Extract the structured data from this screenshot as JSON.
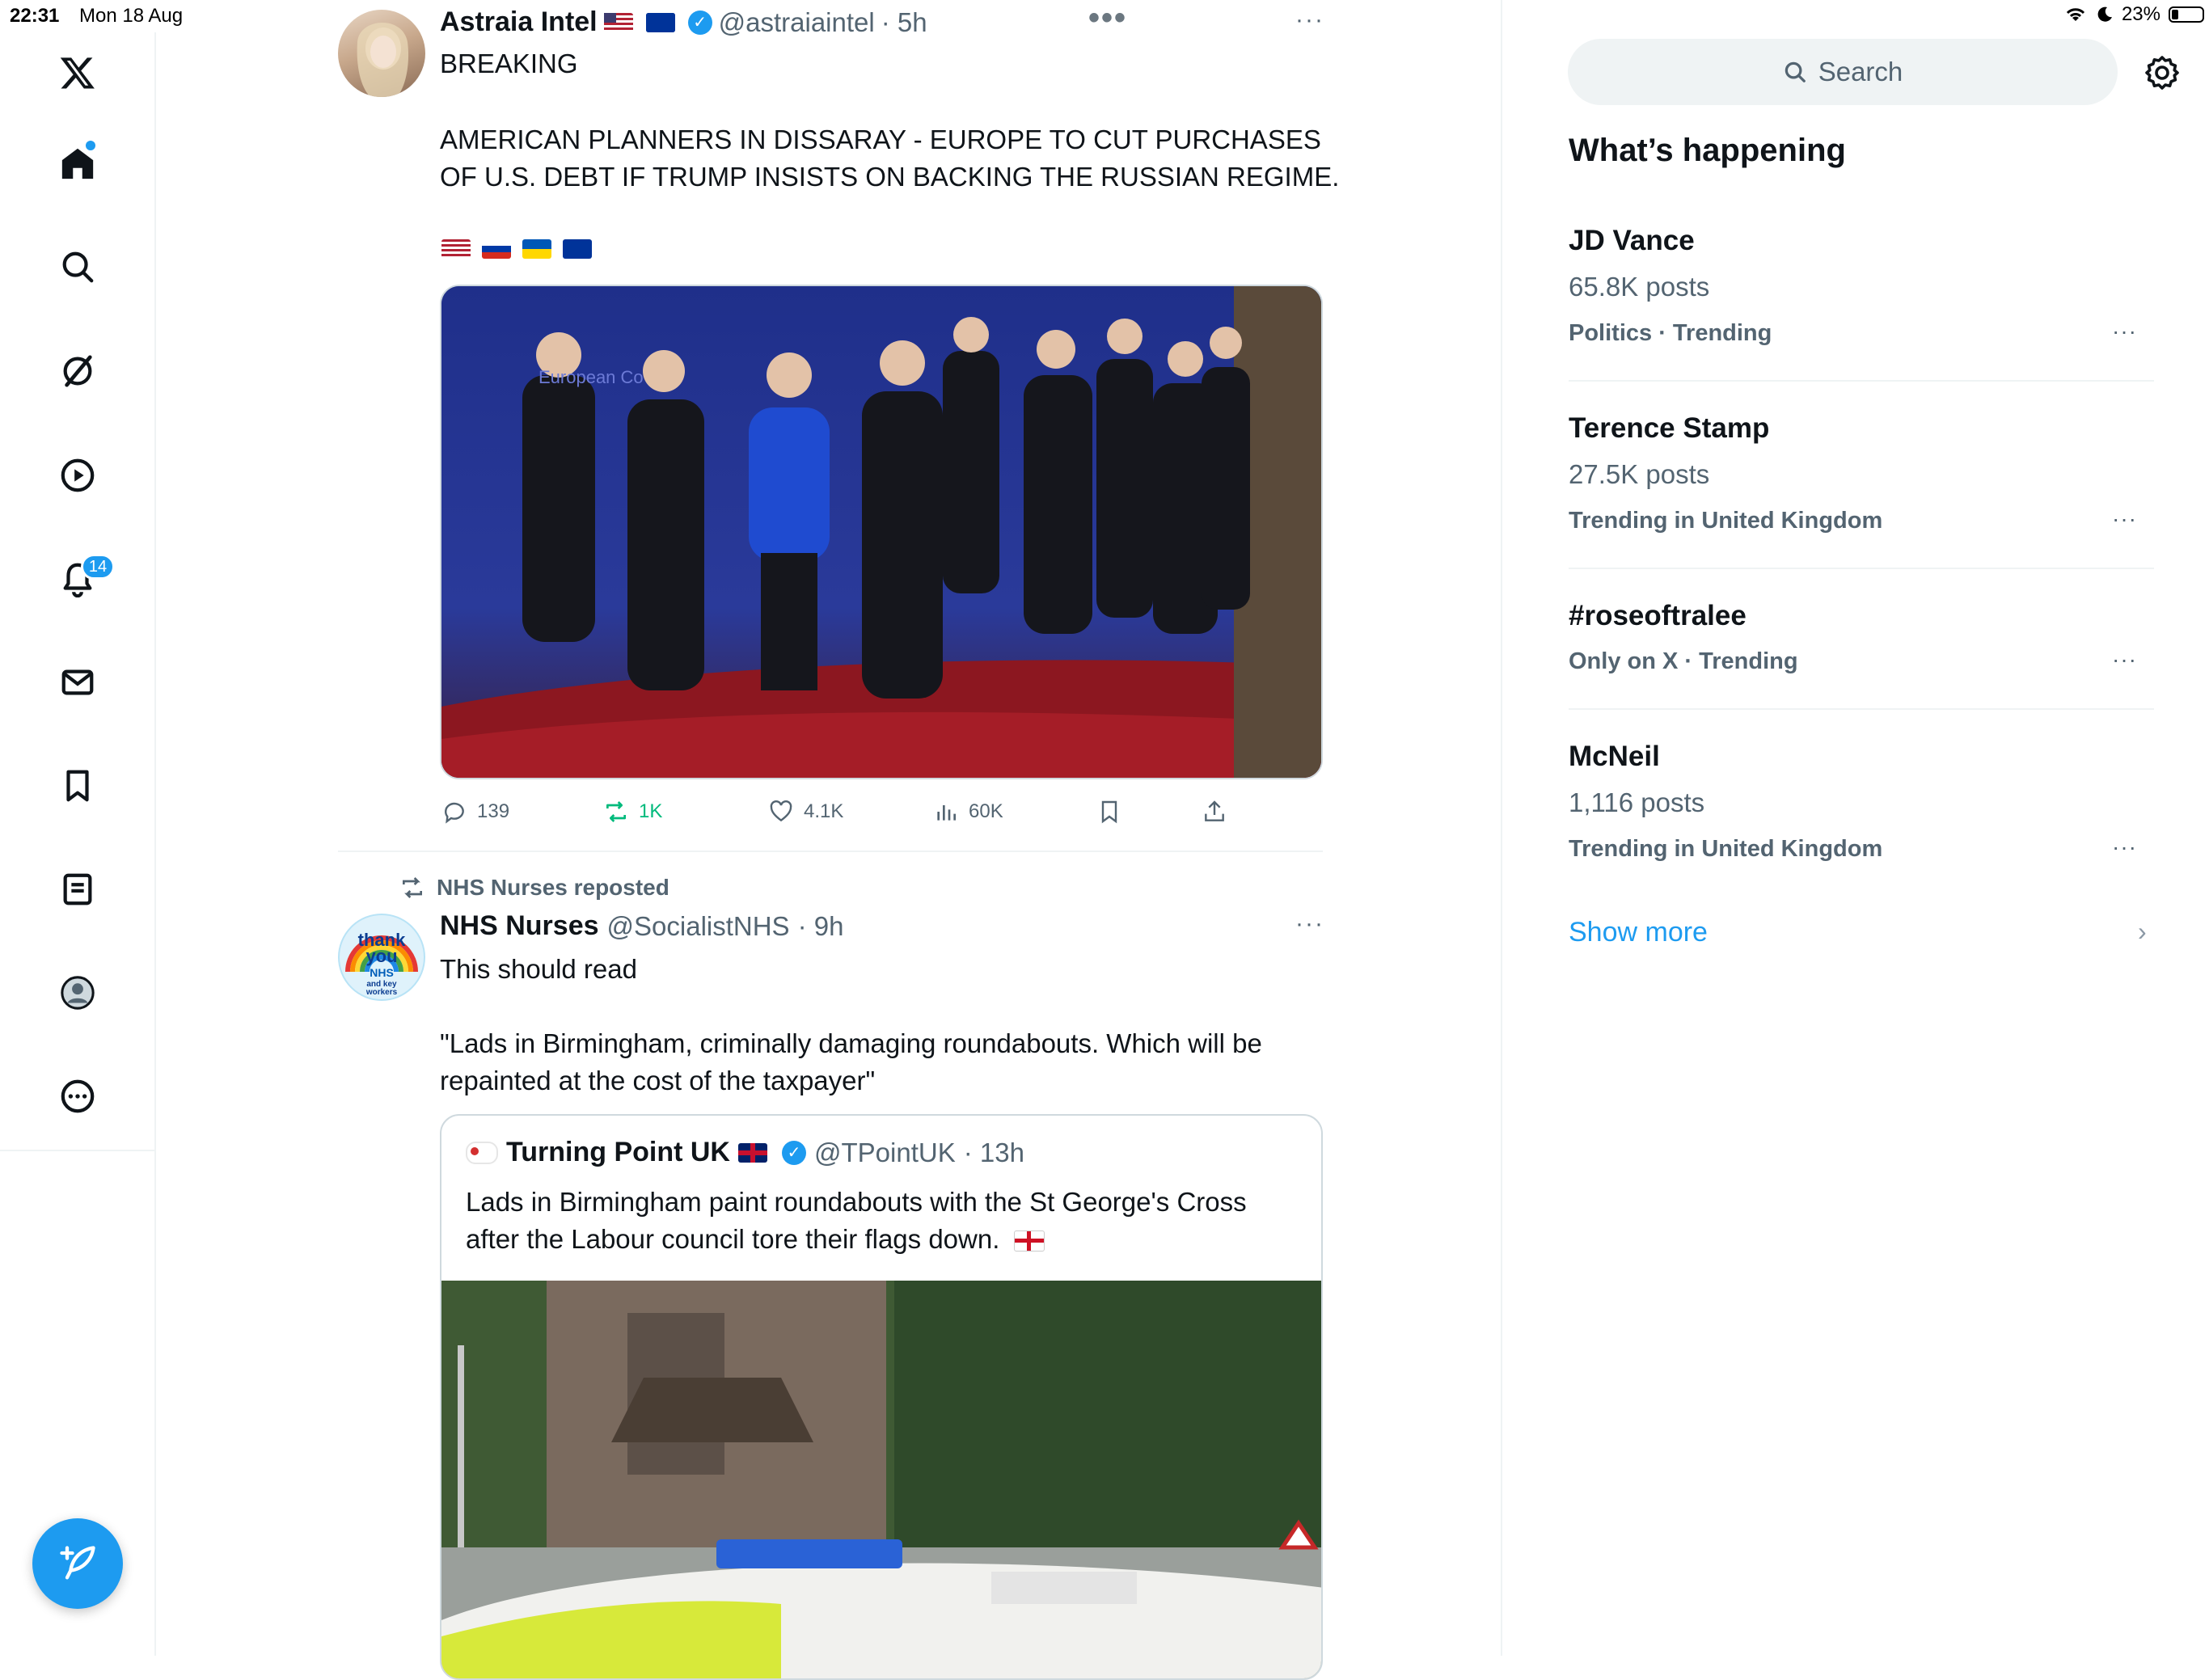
{
  "status_bar": {
    "time": "22:31",
    "date": "Mon 18 Aug",
    "battery": "23%",
    "battery_level": 0.23
  },
  "nav": {
    "items": [
      {
        "icon": "x-logo-icon"
      },
      {
        "icon": "home-icon"
      },
      {
        "icon": "search-icon"
      },
      {
        "icon": "grok-icon"
      },
      {
        "icon": "video-icon"
      },
      {
        "icon": "notifications-icon"
      },
      {
        "icon": "messages-icon"
      },
      {
        "icon": "bookmarks-icon"
      },
      {
        "icon": "lists-icon"
      },
      {
        "icon": "profile-icon"
      },
      {
        "icon": "more-icon"
      }
    ],
    "notifications_badge": "14",
    "compose_icon": "compose-icon"
  },
  "feed": {
    "post1": {
      "name": "Astraia Intel",
      "handle": "@astraiaintel",
      "time": "· 5h",
      "line1": "BREAKING",
      "line2": "AMERICAN PLANNERS IN DISSARAY - EUROPE TO CUT PURCHASES",
      "line3": "OF U.S. DEBT IF TRUMP INSISTS ON BACKING THE RUSSIAN REGIME.",
      "actions": {
        "replies": "139",
        "reposts": "1K",
        "likes": "4.1K",
        "views": "60K"
      }
    },
    "post2": {
      "repost_label": "NHS Nurses reposted",
      "name": "NHS Nurses",
      "handle": "@SocialistNHS",
      "time": "· 9h",
      "avatar_text_1": "thank",
      "avatar_text_2": "you",
      "avatar_text_3": "NHS",
      "avatar_text_4": "and key",
      "avatar_text_5": "workers",
      "line1": "This should read",
      "line2": "\"Lads in Birmingham, criminally damaging roundabouts. Which will be",
      "line3": "repainted at the cost of the taxpayer\"",
      "quote": {
        "name": "Turning Point UK",
        "handle": "@TPointUK",
        "time": "· 13h",
        "line1": "Lads in Birmingham paint roundabouts with the St George's Cross",
        "line2": "after the Labour council tore their flags down."
      }
    }
  },
  "sidebar": {
    "search_placeholder": "Search",
    "heading": "What’s happening",
    "trends": [
      {
        "title": "JD Vance",
        "count": "65.8K posts",
        "meta": "Politics · Trending"
      },
      {
        "title": "Terence Stamp",
        "count": "27.5K posts",
        "meta": "Trending in United Kingdom"
      },
      {
        "title": "#roseoftralee",
        "count": "",
        "meta": "Only on X · Trending"
      },
      {
        "title": "McNeil",
        "count": "1,116 posts",
        "meta": "Trending in United Kingdom"
      }
    ],
    "show_more": "Show more"
  },
  "colors": {
    "accent": "#1d9bf0",
    "repost_green": "#00ba7c",
    "text_secondary": "#536471",
    "border": "#eff3f4"
  }
}
